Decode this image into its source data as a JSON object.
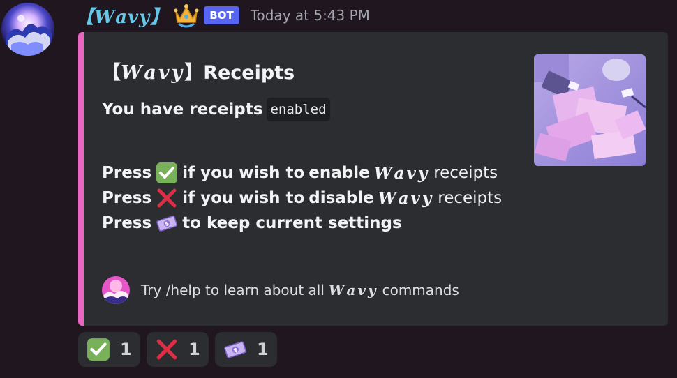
{
  "message": {
    "username": "【𝑾𝒂𝒗𝒚】",
    "bot_badge": "BOT",
    "timestamp": "Today at 5:43 PM"
  },
  "embed": {
    "title_prefix": "【",
    "title_brand": "𝑾𝒂𝒗𝒚",
    "title_suffix": "】Receipts",
    "status_text": "You have receipts",
    "status_value": "enabled",
    "lines": [
      {
        "press": "Press",
        "mid": "if you wish to",
        "action": "enable",
        "brand": "𝑾𝒂𝒗𝒚",
        "end": "receipts"
      },
      {
        "press": "Press",
        "mid": "if you wish to",
        "action": "disable",
        "brand": "𝑾𝒂𝒗𝒚",
        "end": "receipts"
      },
      {
        "press": "Press",
        "text": "to keep current settings"
      }
    ],
    "footer_text_a": "Try /help to learn about all",
    "footer_brand": "𝑾𝒂𝒗𝒚",
    "footer_text_b": "commands",
    "accent_color": "#eb66c3"
  },
  "reactions": [
    {
      "icon": "check-mark-icon",
      "count": "1"
    },
    {
      "icon": "cross-mark-icon",
      "count": "1"
    },
    {
      "icon": "dollar-bill-icon",
      "count": "1"
    }
  ],
  "colors": {
    "background": "#1f1620",
    "embed_bg": "#2b2d31",
    "username": "#66c8e6",
    "bot_badge": "#5865f2"
  }
}
